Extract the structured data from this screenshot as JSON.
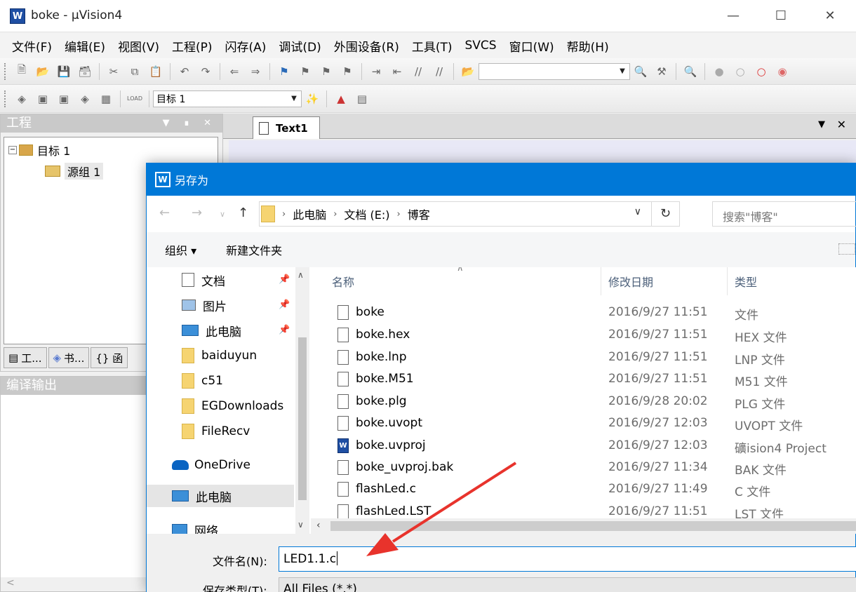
{
  "window": {
    "title": "boke  - µVision4",
    "icon_label": "W"
  },
  "menu": [
    "文件(F)",
    "编辑(E)",
    "视图(V)",
    "工程(P)",
    "闪存(A)",
    "调试(D)",
    "外围设备(R)",
    "工具(T)",
    "SVCS",
    "窗口(W)",
    "帮助(H)"
  ],
  "toolbar2": {
    "target_combo": "目标 1"
  },
  "project_panel": {
    "title": "工程",
    "tree": {
      "target": "目标 1",
      "group": "源组 1"
    },
    "tabs": [
      "工...",
      "书...",
      "{} 函"
    ]
  },
  "output_panel": {
    "title": "编译输出",
    "scroll_left": "<"
  },
  "editor": {
    "tab_label": "Text1"
  },
  "dialog": {
    "title": "另存为",
    "icon_label": "W",
    "breadcrumbs": [
      "此电脑",
      "文档 (E:)",
      "博客"
    ],
    "search_placeholder": "搜索\"博客\"",
    "organize_label": "组织 ▾",
    "new_folder_label": "新建文件夹",
    "nav_items": [
      {
        "label": "文档",
        "icon": "document-icon",
        "pinned": true
      },
      {
        "label": "图片",
        "icon": "pictures-icon",
        "pinned": true
      },
      {
        "label": "此电脑",
        "icon": "computer-icon",
        "pinned": true
      },
      {
        "label": "baiduyun",
        "icon": "folder-icon"
      },
      {
        "label": "c51",
        "icon": "folder-icon"
      },
      {
        "label": "EGDownloads",
        "icon": "folder-icon"
      },
      {
        "label": "FileRecv",
        "icon": "folder-icon"
      },
      {
        "label": "OneDrive",
        "icon": "onedrive-icon"
      },
      {
        "label": "此电脑",
        "icon": "computer-icon",
        "selected": true
      },
      {
        "label": "网络",
        "icon": "network-icon"
      }
    ],
    "columns": {
      "name": "名称",
      "date": "修改日期",
      "type": "类型"
    },
    "files": [
      {
        "name": "boke",
        "date": "2016/9/27 11:51",
        "type": "文件"
      },
      {
        "name": "boke.hex",
        "date": "2016/9/27 11:51",
        "type": "HEX 文件"
      },
      {
        "name": "boke.lnp",
        "date": "2016/9/27 11:51",
        "type": "LNP 文件"
      },
      {
        "name": "boke.M51",
        "date": "2016/9/27 11:51",
        "type": "M51 文件"
      },
      {
        "name": "boke.plg",
        "date": "2016/9/28 20:02",
        "type": "PLG 文件"
      },
      {
        "name": "boke.uvopt",
        "date": "2016/9/27 12:03",
        "type": "UVOPT 文件"
      },
      {
        "name": "boke.uvproj",
        "date": "2016/9/27 12:03",
        "type": "礦ision4 Project",
        "icon": "uvision-project-icon"
      },
      {
        "name": "boke_uvproj.bak",
        "date": "2016/9/27 11:34",
        "type": "BAK 文件"
      },
      {
        "name": "flashLed.c",
        "date": "2016/9/27 11:49",
        "type": "C 文件"
      },
      {
        "name": "flashLed.LST",
        "date": "2016/9/27 11:51",
        "type": "LST 文件"
      }
    ],
    "filename_label": "文件名(N):",
    "filename_value": "LED1.1.c",
    "filetype_label": "保存类型(T):",
    "filetype_value": "All Files (*.*)"
  },
  "colors": {
    "accent": "#0078d7",
    "arrow": "#e8332c"
  }
}
